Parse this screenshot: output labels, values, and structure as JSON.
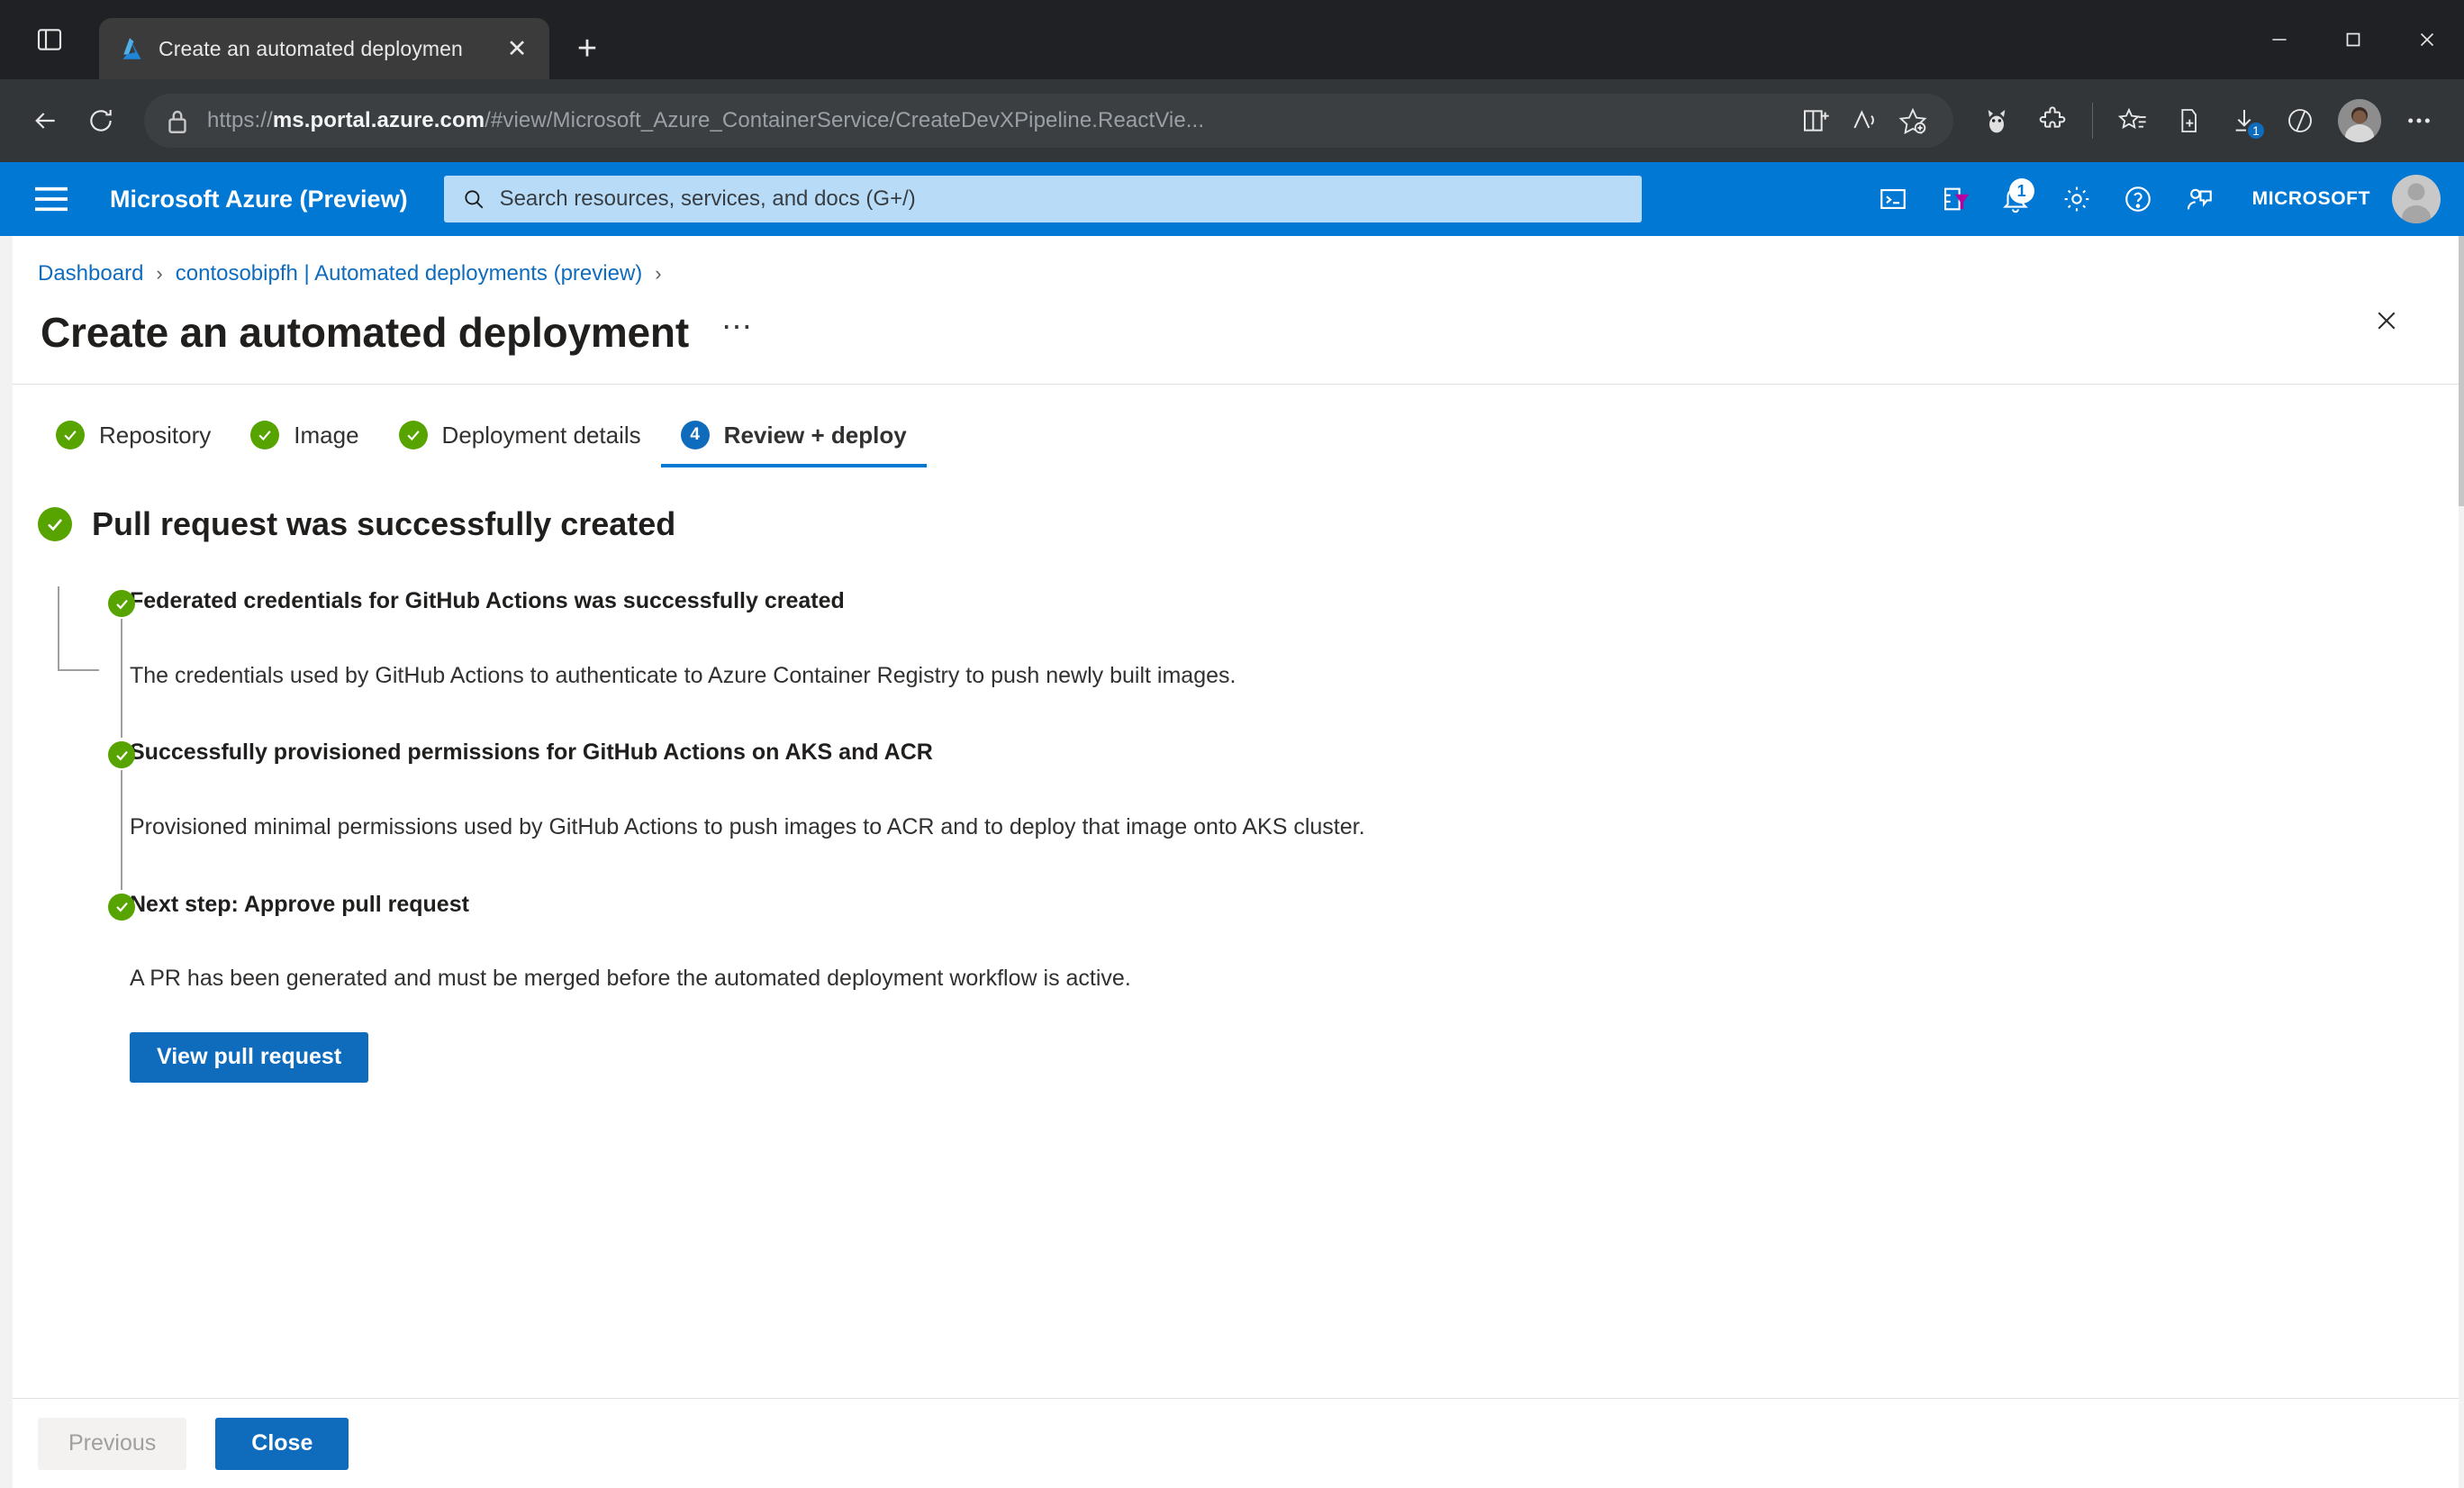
{
  "browser": {
    "tab": {
      "title": "Create an automated deploymen",
      "favicon": "azure-logo-icon",
      "close_label": "✕"
    },
    "new_tab_label": "+",
    "url": {
      "scheme": "https://",
      "host": "ms.portal.azure.com",
      "path": "/#view/Microsoft_Azure_ContainerService/CreateDevXPipeline.ReactVie..."
    },
    "window_controls": {
      "minimize": "–",
      "maximize": "□",
      "close": "✕"
    },
    "toolbar_icons": [
      "back-icon",
      "refresh-icon",
      "lock-icon",
      "split-screen-icon",
      "read-aloud-icon",
      "add-favorite-icon",
      "copilot-icon",
      "extensions-icon",
      "collections-icon",
      "browser-essentials-icon",
      "downloads-icon",
      "split-tab-icon",
      "profile-avatar-icon",
      "settings-more-icon"
    ],
    "downloads_badge": "1"
  },
  "azure_header": {
    "hamburger": "hamburger-menu-icon",
    "brand": "Microsoft Azure (Preview)",
    "search_placeholder": "Search resources, services, and docs (G+/)",
    "icons": [
      "cloud-shell-icon",
      "directories-subscriptions-icon",
      "notifications-icon",
      "settings-gear-icon",
      "help-icon",
      "feedback-icon"
    ],
    "notification_count": "1",
    "tenant": "MICROSOFT",
    "accent": "#0078d4"
  },
  "breadcrumb": {
    "items": [
      {
        "label": "Dashboard"
      },
      {
        "label": "contosobipfh | Automated deployments (preview)"
      }
    ],
    "separator": "›"
  },
  "page": {
    "title": "Create an automated deployment",
    "ellipsis": "⋯",
    "close": "close-icon"
  },
  "wizard": {
    "tabs": [
      {
        "label": "Repository",
        "state": "complete",
        "marker": "✓"
      },
      {
        "label": "Image",
        "state": "complete",
        "marker": "✓"
      },
      {
        "label": "Deployment details",
        "state": "complete",
        "marker": "✓"
      },
      {
        "label": "Review + deploy",
        "state": "active",
        "marker": "4"
      }
    ],
    "active_index": 3
  },
  "result": {
    "status": "success",
    "title": "Pull request was successfully created",
    "success_color": "#57a300",
    "steps": [
      {
        "heading": "Federated credentials for GitHub Actions was successfully created",
        "description": "The credentials used by GitHub Actions to authenticate to Azure Container Registry to push newly built images."
      },
      {
        "heading": "Successfully provisioned permissions for GitHub Actions on AKS and ACR",
        "description": "Provisioned minimal permissions used by GitHub Actions to push images to ACR and to deploy that image onto AKS cluster."
      },
      {
        "heading": "Next step: Approve pull request",
        "description": "A PR has been generated and must be merged before the automated deployment workflow is active.",
        "action_label": "View pull request"
      }
    ]
  },
  "footer": {
    "previous_label": "Previous",
    "close_label": "Close"
  }
}
